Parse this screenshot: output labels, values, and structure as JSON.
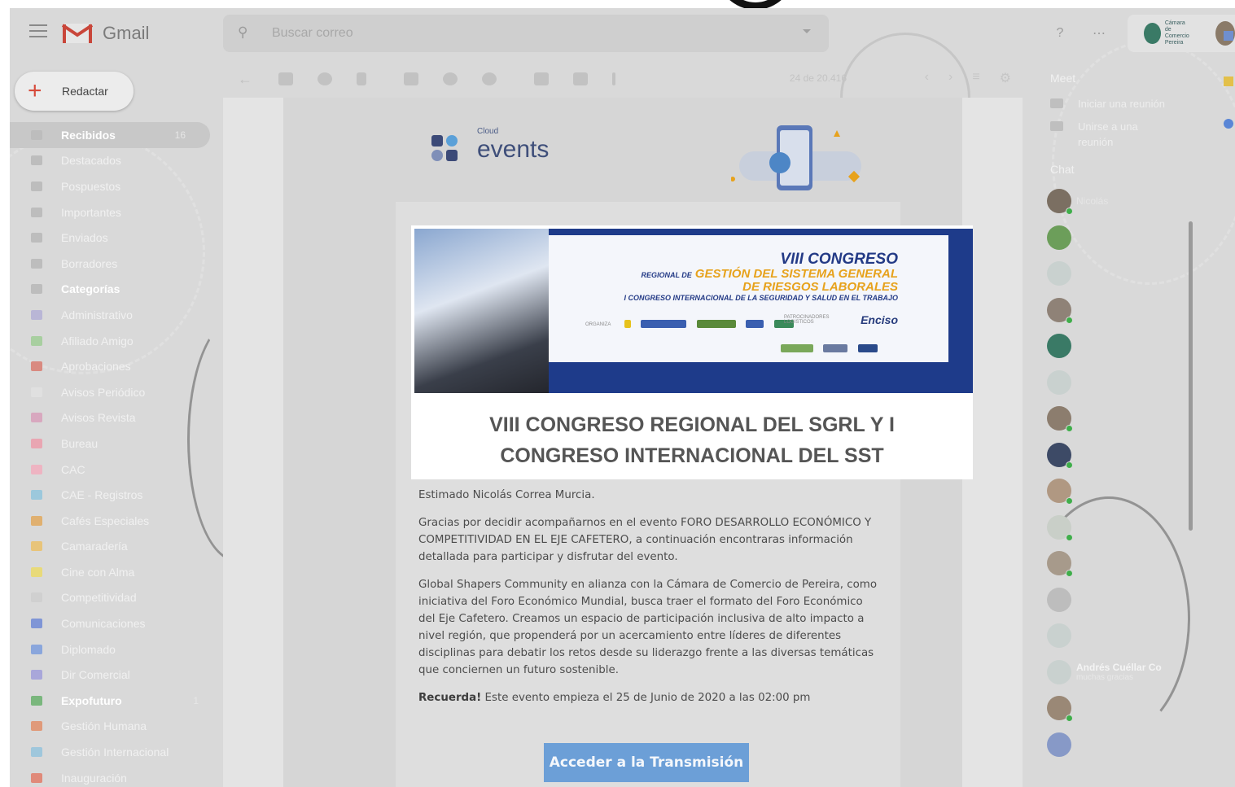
{
  "app": {
    "name": "Gmail"
  },
  "search": {
    "placeholder": "Buscar correo"
  },
  "compose": {
    "label": "Redactar"
  },
  "nav": [
    {
      "label": "Recibidos",
      "count": "16",
      "color": "#bdbdbd"
    },
    {
      "label": "Destacados",
      "color": "#bdbdbd"
    },
    {
      "label": "Pospuestos",
      "color": "#bdbdbd"
    },
    {
      "label": "Importantes",
      "color": "#bdbdbd"
    },
    {
      "label": "Enviados",
      "color": "#bdbdbd"
    },
    {
      "label": "Borradores",
      "color": "#bdbdbd"
    },
    {
      "label": "Categorías",
      "color": "#bdbdbd"
    },
    {
      "label": "Administrativo",
      "color": "#b9b6d6"
    },
    {
      "label": "Afiliado Amigo",
      "color": "#a8cfa0"
    },
    {
      "label": "Aprobaciones",
      "color": "#d98a80"
    },
    {
      "label": "Avisos Periódico",
      "color": "#e0e0e0"
    },
    {
      "label": "Avisos Revista",
      "color": "#d8a8bf"
    },
    {
      "label": "Bureau",
      "color": "#e9a6b2"
    },
    {
      "label": "CAC",
      "color": "#eeb4c2"
    },
    {
      "label": "CAE - Registros",
      "color": "#9cc8dc"
    },
    {
      "label": "Cafés Especiales",
      "color": "#e0b070"
    },
    {
      "label": "Camaradería",
      "color": "#e8c47a"
    },
    {
      "label": "Cine con Alma",
      "color": "#e8da7a"
    },
    {
      "label": "Competitividad",
      "color": "#d0d0d0"
    },
    {
      "label": "Comunicaciones",
      "color": "#7f95d6"
    },
    {
      "label": "Diplomado",
      "color": "#8aa6dc"
    },
    {
      "label": "Dir Comercial",
      "color": "#a9a7da"
    },
    {
      "label": "Expofuturo",
      "count": "1",
      "color": "#7ab77d"
    },
    {
      "label": "Gestión Humana",
      "color": "#e09a7a"
    },
    {
      "label": "Gestión Internacional",
      "color": "#9fc7dc"
    },
    {
      "label": "Inauguración",
      "color": "#e08a7a"
    }
  ],
  "toolbar": {
    "pager": "24 de 20.416"
  },
  "email": {
    "logo_small": "Cloud",
    "logo_main": "events",
    "banner": {
      "line1": "VIII CONGRESO",
      "line2_prefix": "REGIONAL DE",
      "line2": "GESTIÓN DEL SISTEMA GENERAL",
      "line3": "DE RIESGOS LABORALES",
      "line4": "I CONGRESO INTERNACIONAL DE LA SEGURIDAD Y SALUD EN EL TRABAJO",
      "organiza": "ORGANIZA",
      "patrocinadores": "PATROCINADORES LOGISTICOS",
      "sponsor": "Enciso"
    },
    "heading_line1": "VIII CONGRESO REGIONAL DEL SGRL Y I",
    "heading_line2": "CONGRESO INTERNACIONAL DEL SST",
    "greeting": "Estimado Nicolás Correa Murcia.",
    "para1": "Gracias por decidir acompañarnos en el evento FORO DESARROLLO ECONÓMICO Y COMPETITIVIDAD EN EL EJE CAFETERO, a continuación encontraras información detallada para participar y disfrutar del evento.",
    "para2": "Global Shapers Community en alianza con la Cámara de Comercio de Pereira, como iniciativa del Foro Económico Mundial, busca traer el formato del Foro Económico del Eje Cafetero. Creamos un espacio de participación inclusiva de alto impacto a nivel región, que propenderá por un acercamiento entre líderes de diferentes disciplinas para debatir los retos desde su liderazgo frente a las diversas temáticas que conciernen un futuro sostenible.",
    "reminder_bold": "Recuerda!",
    "reminder": " Este evento empieza el 25 de Junio de 2020 a las 02:00 pm",
    "cta": "Acceder a la Transmisión"
  },
  "right_panel": {
    "meet": "Meet",
    "start_meeting": "Iniciar una reunión",
    "join_meeting": "Unirse a una reunión",
    "chat": "Chat",
    "contacts": [
      {
        "name": "Nicolás",
        "sub": "",
        "color": "#7b6f62",
        "online": true
      },
      {
        "name": "",
        "sub": "",
        "color": "#6c9e5a",
        "online": false
      },
      {
        "name": "",
        "sub": "",
        "color": "#c9d1cf",
        "online": false
      },
      {
        "name": "",
        "sub": "",
        "color": "#8f8277",
        "online": true
      },
      {
        "name": "",
        "sub": "",
        "color": "#3a7a66",
        "online": false
      },
      {
        "name": "",
        "sub": "",
        "color": "#c9d1cf",
        "online": false
      },
      {
        "name": "",
        "sub": "",
        "color": "#8c7d6e",
        "online": true
      },
      {
        "name": "",
        "sub": "",
        "color": "#3d4a66",
        "online": true
      },
      {
        "name": "",
        "sub": "",
        "color": "#b09882",
        "online": true
      },
      {
        "name": "",
        "sub": "",
        "color": "#c9cfc8",
        "online": true
      },
      {
        "name": "",
        "sub": "",
        "color": "#a79a8b",
        "online": true
      },
      {
        "name": "",
        "sub": "",
        "color": "#bdbdbd",
        "online": false
      },
      {
        "name": "",
        "sub": "",
        "color": "#c9d1cf",
        "online": false
      },
      {
        "name": "Andrés Cuéllar Co",
        "sub": "muchas gracias",
        "color": "#c9d1cf",
        "online": false
      },
      {
        "name": "",
        "sub": "",
        "color": "#9a8876",
        "online": true
      },
      {
        "name": "",
        "sub": "",
        "color": "#8799c7",
        "online": false
      }
    ]
  },
  "account": {
    "org": "Cámara de Comercio Pereira"
  }
}
